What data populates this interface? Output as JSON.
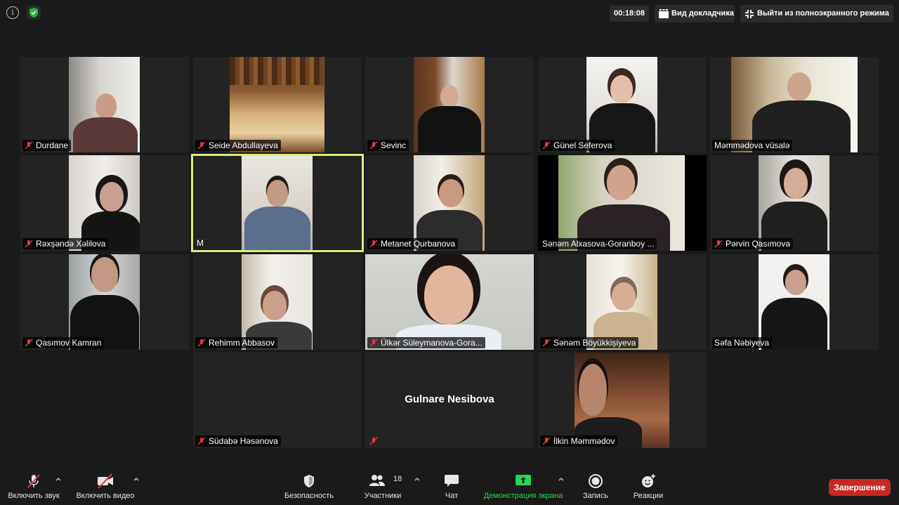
{
  "topbar": {
    "timer": "00:18:08",
    "speaker_view_label": "Вид докладчика",
    "exit_fullscreen_label": "Выйти из полноэкранного режима"
  },
  "participants": [
    {
      "name": "Durdane",
      "muted": true
    },
    {
      "name": "Seide Abdullayeva",
      "muted": true
    },
    {
      "name": "Sevinc",
      "muted": true
    },
    {
      "name": "Günel Seferova",
      "muted": true
    },
    {
      "name": "Məmmədova vüsalə",
      "muted": false
    },
    {
      "name": "Rəxşəndə Xəlilova",
      "muted": true
    },
    {
      "name": "M",
      "muted": false
    },
    {
      "name": "Metanet Qurbanova",
      "muted": true
    },
    {
      "name": "Sənəm Alxasova-Goranboy ...",
      "muted": false
    },
    {
      "name": "Pərvin Qasımova",
      "muted": true
    },
    {
      "name": "Qasımov Kamran",
      "muted": true
    },
    {
      "name": "Rehimm Abbasov",
      "muted": true
    },
    {
      "name": "Ülkər Süleymanova-Gora...",
      "muted": true
    },
    {
      "name": "Sənəm Böyükkişiyeva",
      "muted": true
    },
    {
      "name": "Səfa Nəbiyeva",
      "muted": false
    },
    {
      "name": "Südabə Həsənova",
      "muted": true
    },
    {
      "name": "Gulnare Nesibova",
      "muted": true
    },
    {
      "name": "İlkin Məmmədov",
      "muted": true
    }
  ],
  "toolbar": {
    "unmute_label": "Включить звук",
    "start_video_label": "Включить видео",
    "security_label": "Безопасность",
    "participants_label": "Участники",
    "participants_count": "18",
    "chat_label": "Чат",
    "share_screen_label": "Демонстрация экрана",
    "record_label": "Запись",
    "reactions_label": "Реакции",
    "end_label": "Завершение"
  },
  "colors": {
    "active_speaker_border": "#d6f075",
    "share_green": "#23d959",
    "end_red": "#c52723",
    "mute_red": "#e0393e"
  }
}
